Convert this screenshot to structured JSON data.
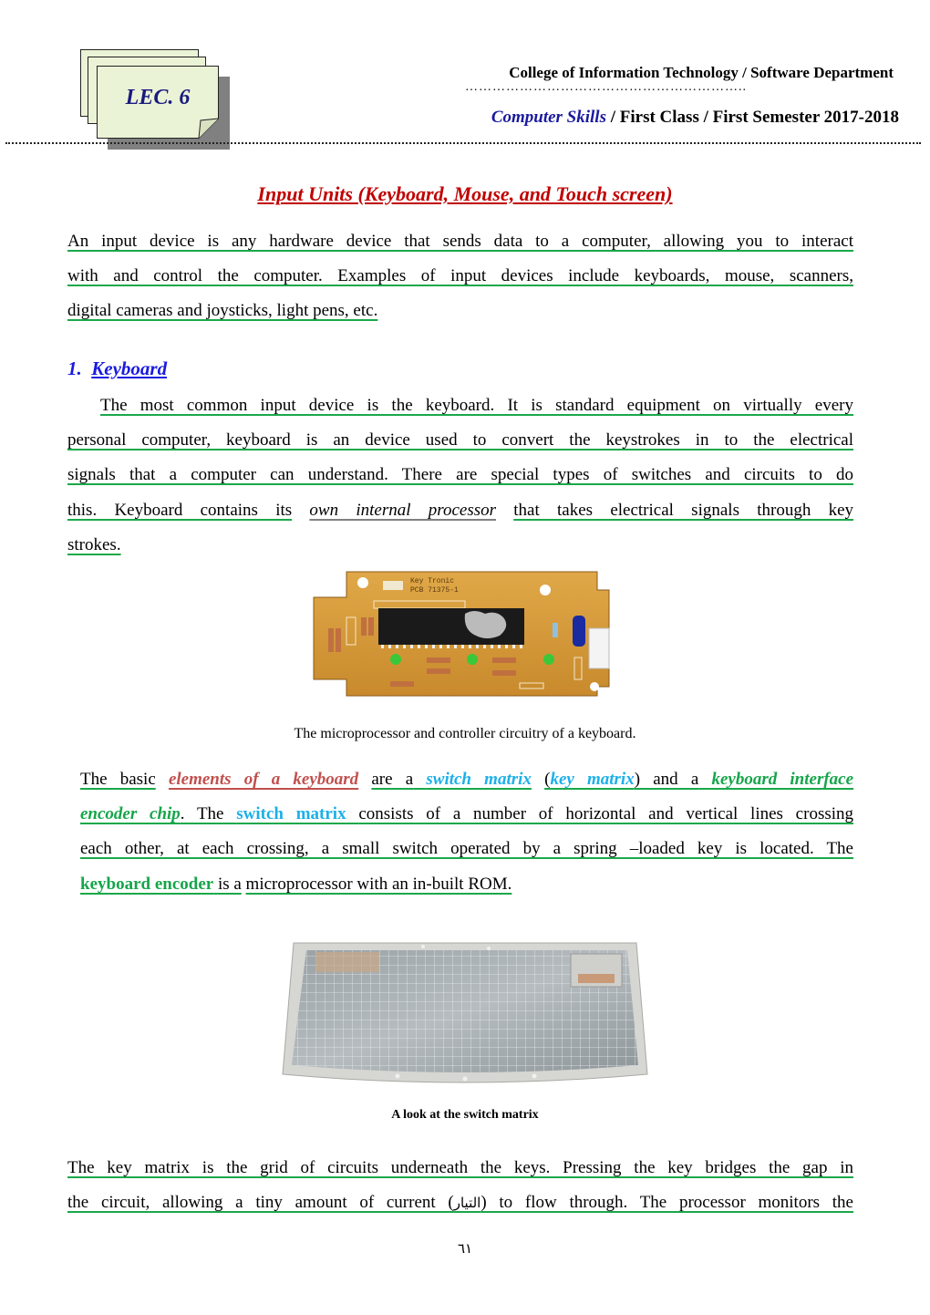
{
  "header": {
    "lecture_badge": "LEC. 6",
    "college": "College of Information Technology / Software Department",
    "dots": "……………………………………………………..",
    "course_name": "Computer Skills",
    "course_rest": " / First Class / First Semester 2017-2018"
  },
  "title": "Input Units (Keyboard, Mouse, and Touch screen)",
  "intro": {
    "lines": [
      "An input device is any hardware device that sends data to a computer, allowing you to interact",
      "with and control the computer. Examples of input devices include keyboards, mouse, scanners,",
      "digital cameras and joysticks, light pens, etc."
    ]
  },
  "section1": {
    "number": "1.",
    "heading": "Keyboard",
    "lines": [
      "The most common input device is the keyboard. It is standard equipment on virtually every",
      "personal computer, keyboard is an device used to convert the keystrokes in to the electrical",
      "signals that a computer can understand. There are special types of switches and circuits to do"
    ],
    "line4_a": "this. Keyboard contains its",
    "line4_em": "own internal processor",
    "line4_b": "that takes electrical signals through key",
    "line5": "strokes."
  },
  "figure1": {
    "caption": "The microprocessor and controller circuitry of a keyboard.",
    "board_label_1": "Key Tronic",
    "board_label_2": "PCB 71375-1"
  },
  "elements_para": {
    "l1_a": "The basic",
    "l1_em1": "elements of a keyboard",
    "l1_b": "are a",
    "l1_em2": "switch matrix",
    "l1_c": "(",
    "l1_em3": "key matrix",
    "l1_d": ") and a",
    "l1_em4": "keyboard interface",
    "l2_em": "encoder chip",
    "l2_a": ". The",
    "l2_b": "switch matrix",
    "l2_c": "consists of a number of horizontal and vertical lines crossing",
    "l3": "each other, at each crossing, a small switch operated by a spring –loaded key is located. The",
    "l4_b": "keyboard encoder",
    "l4_a": "is a",
    "l4_c": "microprocessor with an in-built ROM."
  },
  "figure2": {
    "caption": "A look at the switch matrix"
  },
  "key_matrix_para": {
    "l1": "The key matrix is the grid of circuits underneath the keys. Pressing the key bridges the gap in",
    "l2_a": "the circuit, allowing a tiny amount of current (",
    "l2_arabic": "التيار",
    "l2_b": ") to flow through. The processor monitors the"
  },
  "page_number": "٦١"
}
